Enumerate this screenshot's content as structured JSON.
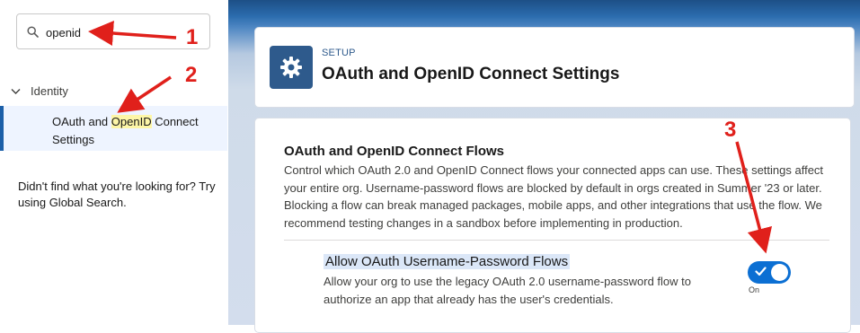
{
  "sidebar": {
    "search_value": "openid",
    "tree_section": "Identity",
    "tree_item_before": "OAuth and ",
    "tree_item_highlight": "OpenID",
    "tree_item_after": " Connect Settings",
    "not_found": "Didn't find what you're looking for? Try using Global Search."
  },
  "header": {
    "setup_label": "SETUP",
    "title": "OAuth and OpenID Connect Settings"
  },
  "content": {
    "section_title": "OAuth and OpenID Connect Flows",
    "section_desc": "Control which OAuth 2.0 and OpenID Connect flows your connected apps can use. These settings affect your entire org. Username-password flows are blocked by default in orgs created in Summer '23 or later. Blocking a flow can break managed packages, mobile apps, and other integrations that use the flow. We recommend testing changes in a sandbox before implementing in production.",
    "setting_title": "Allow OAuth Username-Password Flows",
    "setting_desc": "Allow your org to use the legacy OAuth 2.0 username-password flow to authorize an app that already has the user's credentials.",
    "toggle_label": "On",
    "toggle_on": true
  },
  "annotations": {
    "n1": "1",
    "n2": "2",
    "n3": "3"
  },
  "colors": {
    "accent": "#0b6fd3",
    "brand": "#2e5a8c",
    "annotation": "#e0201b",
    "highlight": "#fdf6a7"
  },
  "icons": [
    "search-icon",
    "chevron-down-icon",
    "gear-icon",
    "check-icon"
  ]
}
